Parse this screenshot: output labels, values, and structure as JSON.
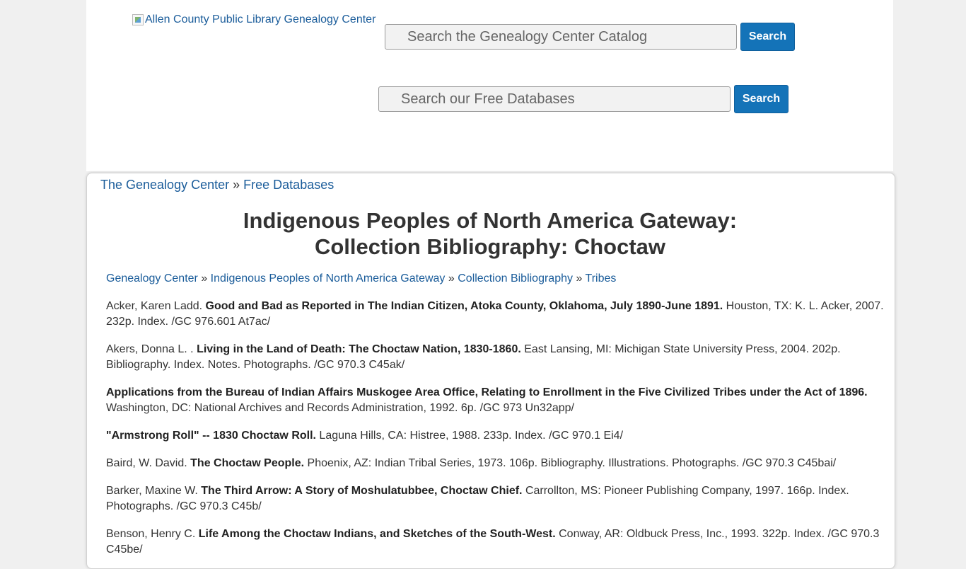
{
  "header": {
    "logo_alt": "Allen County Public Library Genealogy Center",
    "catalog_search": {
      "placeholder": "Search the Genealogy Center Catalog",
      "button": "Search"
    },
    "database_search": {
      "placeholder": "Search our Free Databases",
      "button": "Search"
    }
  },
  "breadcrumb_top": {
    "items": [
      "The Genealogy Center",
      "Free Databases"
    ],
    "separator": "»"
  },
  "title": {
    "line1": "Indigenous Peoples of North America Gateway:",
    "line2": "Collection Bibliography: Choctaw"
  },
  "breadcrumb_sub": {
    "items": [
      "Genealogy Center",
      "Indigenous Peoples of North America Gateway",
      "Collection Bibliography",
      "Tribes"
    ],
    "separator": "»"
  },
  "entries": [
    {
      "author": "Acker, Karen Ladd. ",
      "title": "Good and Bad as Reported in The Indian Citizen, Atoka County, Oklahoma, July 1890-June 1891.",
      "details": " Houston, TX: K. L. Acker, 2007. 232p. Index. /GC 976.601 At7ac/"
    },
    {
      "author": "Akers, Donna L. . ",
      "title": "Living in the Land of Death: The Choctaw Nation, 1830-1860.",
      "details": " East Lansing, MI: Michigan State University Press, 2004. 202p. Bibliography. Index. Notes. Photographs. /GC 970.3 C45ak/"
    },
    {
      "author": "",
      "title": "Applications from the Bureau of Indian Affairs Muskogee Area Office, Relating to Enrollment in the Five Civilized Tribes under the Act of 1896.",
      "details": " Washington, DC: National Archives and Records Administration, 1992. 6p. /GC 973 Un32app/"
    },
    {
      "author": "",
      "title": "\"Armstrong Roll\" -- 1830 Choctaw Roll.",
      "details": " Laguna Hills, CA: Histree, 1988. 233p. Index. /GC 970.1 Ei4/"
    },
    {
      "author": "Baird, W. David. ",
      "title": "The Choctaw People.",
      "details": " Phoenix, AZ: Indian Tribal Series, 1973. 106p. Bibliography. Illustrations. Photographs. /GC 970.3 C45bai/"
    },
    {
      "author": "Barker, Maxine W. ",
      "title": "The Third Arrow: A Story of Moshulatubbee, Choctaw Chief.",
      "details": " Carrollton, MS: Pioneer Publishing Company, 1997. 166p. Index. Photographs. /GC 970.3 C45b/"
    },
    {
      "author": "Benson, Henry C. ",
      "title": "Life Among the Choctaw Indians, and Sketches of the South-West.",
      "details": " Conway, AR: Oldbuck Press, Inc., 1993. 322p. Index. /GC 970.3 C45be/"
    }
  ]
}
